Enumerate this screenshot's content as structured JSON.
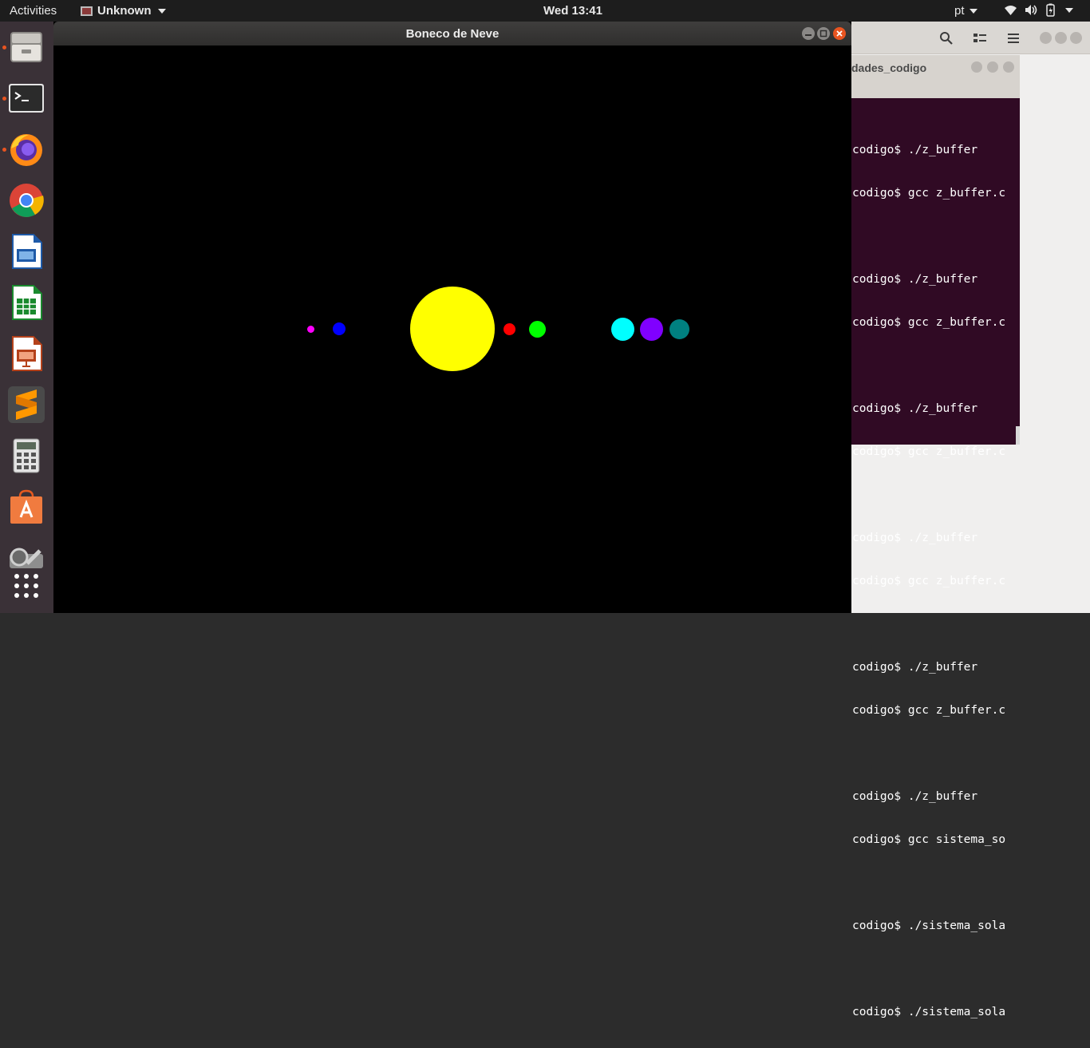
{
  "topbar": {
    "activities": "Activities",
    "app_menu": "Unknown",
    "clock": "Wed 13:41",
    "lang": "pt"
  },
  "dock": {
    "items": [
      {
        "name": "files-icon",
        "running": true
      },
      {
        "name": "terminal-icon",
        "running": true
      },
      {
        "name": "firefox-icon",
        "running": true
      },
      {
        "name": "chrome-icon",
        "running": false
      },
      {
        "name": "writer-icon",
        "running": false
      },
      {
        "name": "calc-icon",
        "running": false
      },
      {
        "name": "impress-icon",
        "running": false
      },
      {
        "name": "sublime-icon",
        "running": false
      },
      {
        "name": "calculator-icon",
        "running": false
      },
      {
        "name": "software-center-icon",
        "running": false
      },
      {
        "name": "settings-icon",
        "running": false
      },
      {
        "name": "show-apps-icon",
        "running": false
      }
    ]
  },
  "main_window": {
    "title": "Boneco de Neve"
  },
  "scene": {
    "planets": [
      {
        "name": "magenta-planet",
        "color": "#ff00ff"
      },
      {
        "name": "blue-planet",
        "color": "#0000ff"
      },
      {
        "name": "sun",
        "color": "#ffff00"
      },
      {
        "name": "red-planet",
        "color": "#ff0000"
      },
      {
        "name": "green-planet",
        "color": "#00ff00"
      },
      {
        "name": "cyan-planet",
        "color": "#00ffff"
      },
      {
        "name": "purple-planet",
        "color": "#8000ff"
      },
      {
        "name": "teal-planet",
        "color": "#008080"
      }
    ]
  },
  "terminal": {
    "title": "dades_codigo",
    "lines": [
      "codigo$ ./z_buffer",
      "codigo$ gcc z_buffer.c",
      "",
      "codigo$ ./z_buffer",
      "codigo$ gcc z_buffer.c",
      "",
      "codigo$ ./z_buffer",
      "codigo$ gcc z_buffer.c",
      "",
      "codigo$ ./z_buffer",
      "codigo$ gcc z_buffer.c",
      "",
      "codigo$ ./z_buffer",
      "codigo$ gcc z_buffer.c",
      "",
      "codigo$ ./z_buffer",
      "codigo$ gcc sistema_so",
      "",
      "codigo$ ./sistema_sola",
      "",
      "codigo$ ./sistema_sola"
    ]
  }
}
